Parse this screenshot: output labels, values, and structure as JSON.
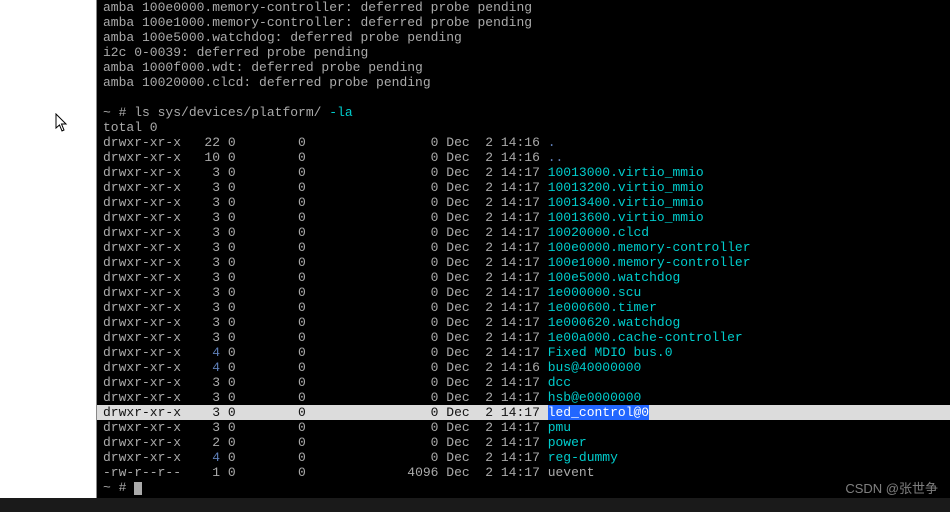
{
  "boot_messages": [
    "amba 100e0000.memory-controller: deferred probe pending",
    "amba 100e1000.memory-controller: deferred probe pending",
    "amba 100e5000.watchdog: deferred probe pending",
    "i2c 0-0039: deferred probe pending",
    "amba 1000f000.wdt: deferred probe pending",
    "amba 10020000.clcd: deferred probe pending"
  ],
  "prompt1": {
    "ps": "~ # ",
    "cmd": "ls sys/devices/platform/ ",
    "flags": "-la"
  },
  "total_line": "total 0",
  "ls_rows": [
    {
      "perm": "drwxr-xr-x",
      "links": "22",
      "own": "0",
      "grp": "0",
      "size": "0",
      "date": "Dec  2 14:16",
      "name": ".",
      "cls": "blue"
    },
    {
      "perm": "drwxr-xr-x",
      "links": "10",
      "own": "0",
      "grp": "0",
      "size": "0",
      "date": "Dec  2 14:16",
      "name": "..",
      "cls": "blue"
    },
    {
      "perm": "drwxr-xr-x",
      "links": "3",
      "own": "0",
      "grp": "0",
      "size": "0",
      "date": "Dec  2 14:17",
      "name": "10013000.virtio_mmio",
      "cls": "cyan"
    },
    {
      "perm": "drwxr-xr-x",
      "links": "3",
      "own": "0",
      "grp": "0",
      "size": "0",
      "date": "Dec  2 14:17",
      "name": "10013200.virtio_mmio",
      "cls": "cyan"
    },
    {
      "perm": "drwxr-xr-x",
      "links": "3",
      "own": "0",
      "grp": "0",
      "size": "0",
      "date": "Dec  2 14:17",
      "name": "10013400.virtio_mmio",
      "cls": "cyan"
    },
    {
      "perm": "drwxr-xr-x",
      "links": "3",
      "own": "0",
      "grp": "0",
      "size": "0",
      "date": "Dec  2 14:17",
      "name": "10013600.virtio_mmio",
      "cls": "cyan"
    },
    {
      "perm": "drwxr-xr-x",
      "links": "3",
      "own": "0",
      "grp": "0",
      "size": "0",
      "date": "Dec  2 14:17",
      "name": "10020000.clcd",
      "cls": "cyan"
    },
    {
      "perm": "drwxr-xr-x",
      "links": "3",
      "own": "0",
      "grp": "0",
      "size": "0",
      "date": "Dec  2 14:17",
      "name": "100e0000.memory-controller",
      "cls": "cyan"
    },
    {
      "perm": "drwxr-xr-x",
      "links": "3",
      "own": "0",
      "grp": "0",
      "size": "0",
      "date": "Dec  2 14:17",
      "name": "100e1000.memory-controller",
      "cls": "cyan"
    },
    {
      "perm": "drwxr-xr-x",
      "links": "3",
      "own": "0",
      "grp": "0",
      "size": "0",
      "date": "Dec  2 14:17",
      "name": "100e5000.watchdog",
      "cls": "cyan"
    },
    {
      "perm": "drwxr-xr-x",
      "links": "3",
      "own": "0",
      "grp": "0",
      "size": "0",
      "date": "Dec  2 14:17",
      "name": "1e000000.scu",
      "cls": "cyan"
    },
    {
      "perm": "drwxr-xr-x",
      "links": "3",
      "own": "0",
      "grp": "0",
      "size": "0",
      "date": "Dec  2 14:17",
      "name": "1e000600.timer",
      "cls": "cyan"
    },
    {
      "perm": "drwxr-xr-x",
      "links": "3",
      "own": "0",
      "grp": "0",
      "size": "0",
      "date": "Dec  2 14:17",
      "name": "1e000620.watchdog",
      "cls": "cyan"
    },
    {
      "perm": "drwxr-xr-x",
      "links": "3",
      "own": "0",
      "grp": "0",
      "size": "0",
      "date": "Dec  2 14:17",
      "name": "1e00a000.cache-controller",
      "cls": "cyan"
    },
    {
      "perm": "drwxr-xr-x",
      "links": "4",
      "own": "0",
      "grp": "0",
      "size": "0",
      "date": "Dec  2 14:17",
      "name": "Fixed MDIO bus.0",
      "cls": "cyan",
      "links_blue": true
    },
    {
      "perm": "drwxr-xr-x",
      "links": "4",
      "own": "0",
      "grp": "0",
      "size": "0",
      "date": "Dec  2 14:16",
      "name": "bus@40000000",
      "cls": "cyan",
      "links_blue": true
    },
    {
      "perm": "drwxr-xr-x",
      "links": "3",
      "own": "0",
      "grp": "0",
      "size": "0",
      "date": "Dec  2 14:17",
      "name": "dcc",
      "cls": "cyan"
    },
    {
      "perm": "drwxr-xr-x",
      "links": "3",
      "own": "0",
      "grp": "0",
      "size": "0",
      "date": "Dec  2 14:17",
      "name": "hsb@e0000000",
      "cls": "cyan"
    },
    {
      "perm": "drwxr-xr-x",
      "links": "3",
      "own": "0",
      "grp": "0",
      "size": "0",
      "date": "Dec  2 14:17",
      "name": "led_control@0",
      "cls": "cyan",
      "highlighted": true
    },
    {
      "perm": "drwxr-xr-x",
      "links": "3",
      "own": "0",
      "grp": "0",
      "size": "0",
      "date": "Dec  2 14:17",
      "name": "pmu",
      "cls": "cyan"
    },
    {
      "perm": "drwxr-xr-x",
      "links": "2",
      "own": "0",
      "grp": "0",
      "size": "0",
      "date": "Dec  2 14:17",
      "name": "power",
      "cls": "cyan"
    },
    {
      "perm": "drwxr-xr-x",
      "links": "4",
      "own": "0",
      "grp": "0",
      "size": "0",
      "date": "Dec  2 14:17",
      "name": "reg-dummy",
      "cls": "cyan",
      "links_blue": true
    },
    {
      "perm": "-rw-r--r--",
      "links": "1",
      "own": "0",
      "grp": "0",
      "size": "4096",
      "date": "Dec  2 14:17",
      "name": "uevent",
      "cls": "grey"
    }
  ],
  "prompt2": {
    "ps": "~ # "
  },
  "watermark": "CSDN @张世争"
}
